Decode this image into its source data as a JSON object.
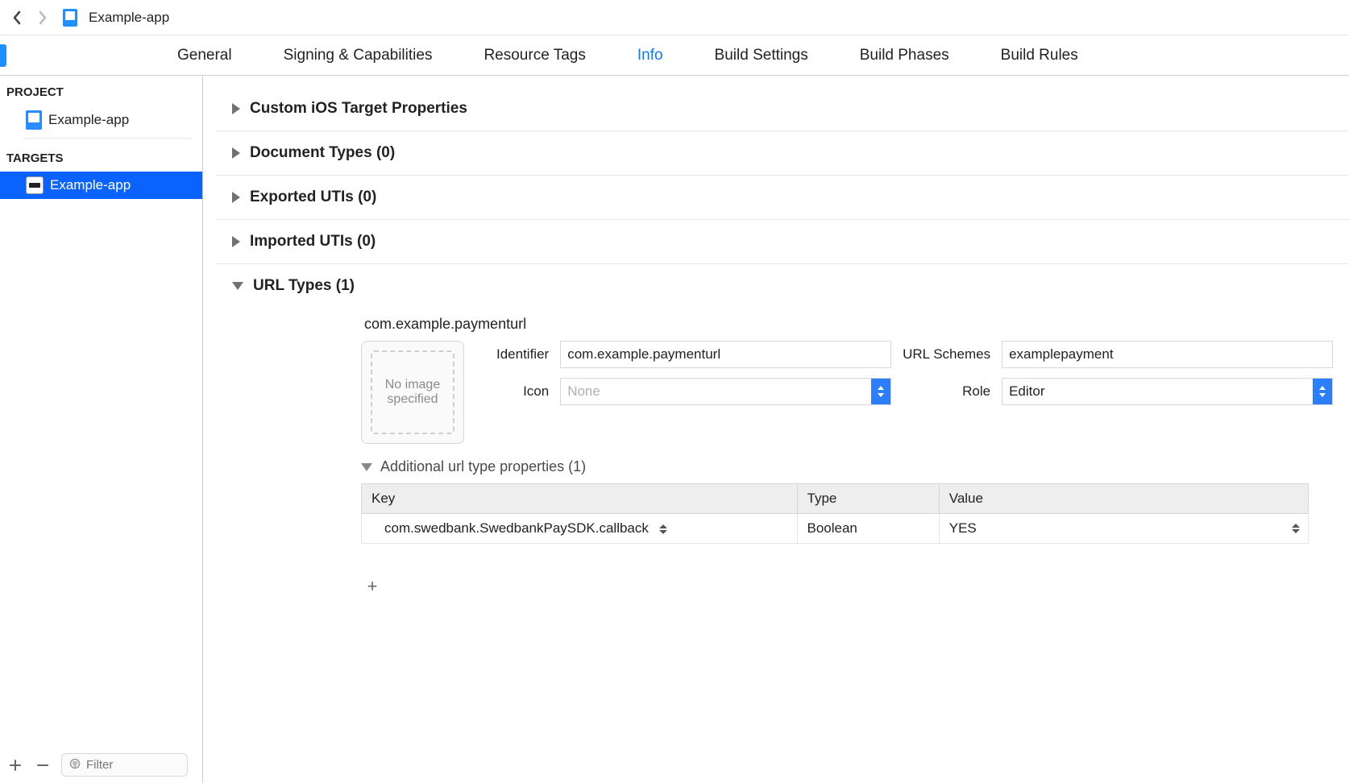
{
  "toolbar": {
    "doc_title": "Example-app"
  },
  "tabs": {
    "items": [
      {
        "label": "General",
        "active": false
      },
      {
        "label": "Signing & Capabilities",
        "active": false
      },
      {
        "label": "Resource Tags",
        "active": false
      },
      {
        "label": "Info",
        "active": true
      },
      {
        "label": "Build Settings",
        "active": false
      },
      {
        "label": "Build Phases",
        "active": false
      },
      {
        "label": "Build Rules",
        "active": false
      }
    ]
  },
  "sidebar": {
    "project_label": "PROJECT",
    "project_item": "Example-app",
    "targets_label": "TARGETS",
    "target_item": "Example-app",
    "filter_placeholder": "Filter"
  },
  "sections": {
    "custom_props": "Custom iOS Target Properties",
    "doc_types": "Document Types (0)",
    "exported_utis": "Exported UTIs (0)",
    "imported_utis": "Imported UTIs (0)",
    "url_types": "URL Types (1)"
  },
  "url_type": {
    "bundle_id": "com.example.paymenturl",
    "image_well": "No image specified",
    "labels": {
      "identifier": "Identifier",
      "url_schemes": "URL Schemes",
      "icon": "Icon",
      "role": "Role"
    },
    "identifier_value": "com.example.paymenturl",
    "schemes_value": "examplepayment",
    "icon_value": "None",
    "role_value": "Editor",
    "additional_header": "Additional url type properties (1)",
    "table": {
      "headers": {
        "key": "Key",
        "type": "Type",
        "value": "Value"
      },
      "rows": [
        {
          "key": "com.swedbank.SwedbankPaySDK.callback",
          "type": "Boolean",
          "value": "YES"
        }
      ]
    }
  }
}
